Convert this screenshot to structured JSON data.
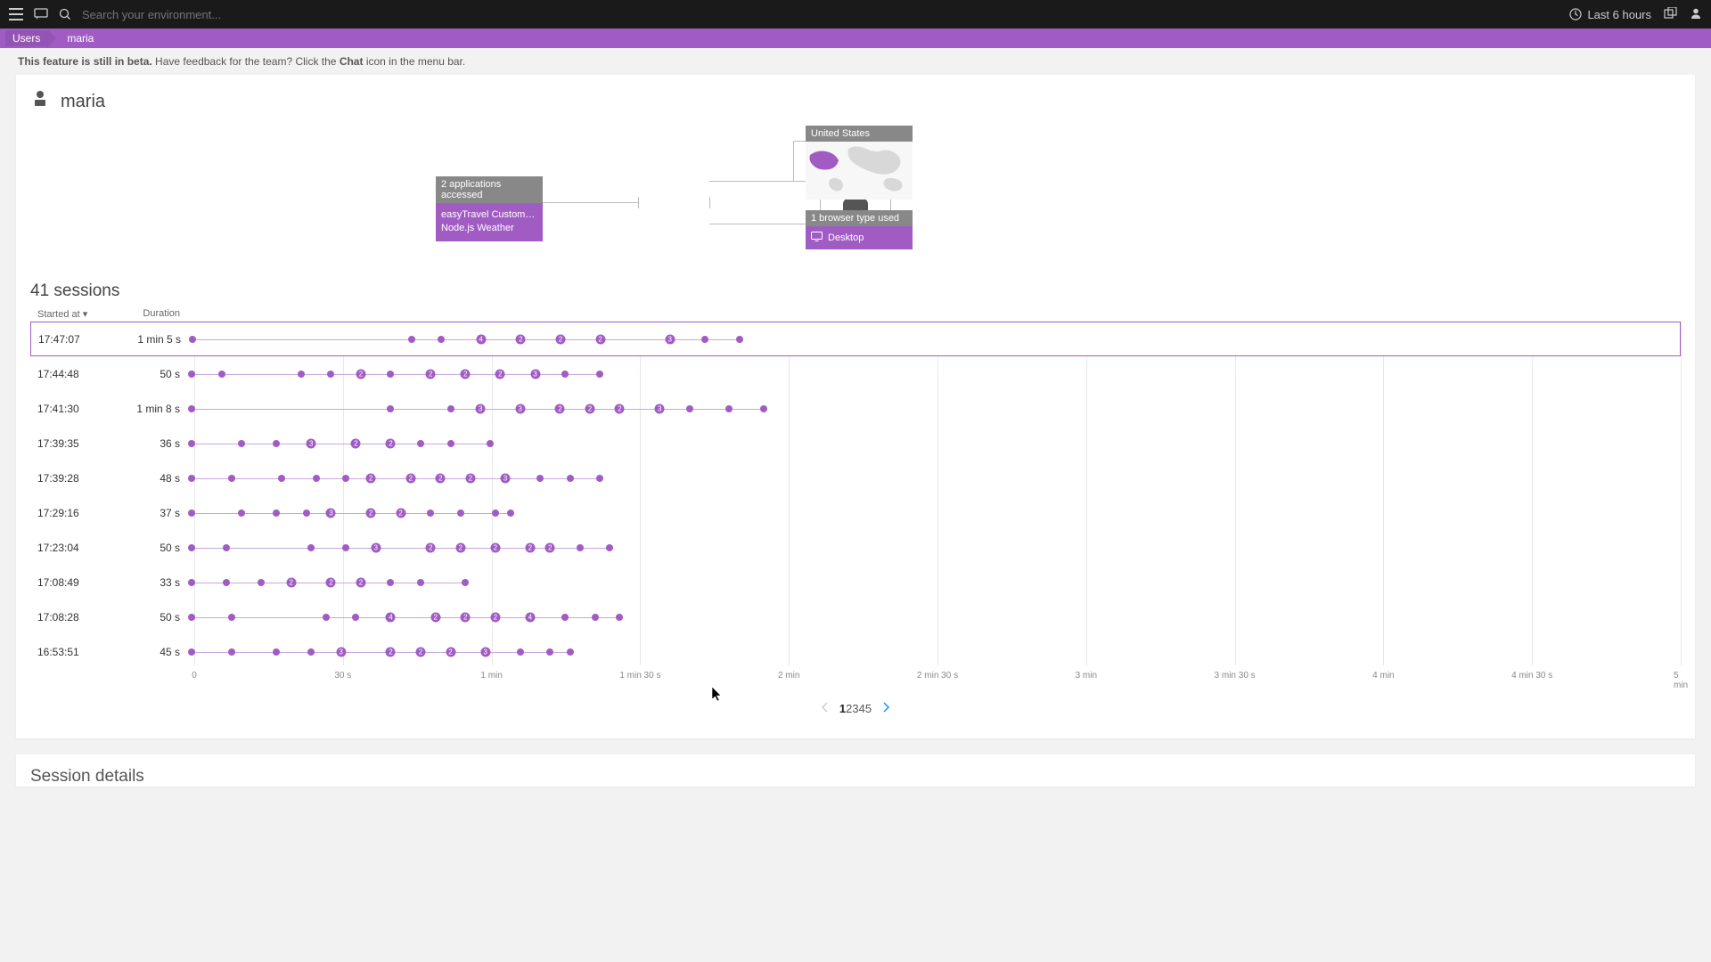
{
  "topbar": {
    "search_placeholder": "Search your environment...",
    "time_label": "Last 6 hours"
  },
  "breadcrumb": {
    "root": "Users",
    "current": "maria"
  },
  "beta": {
    "bold": "This feature is still in beta.",
    "prefix": " Have feedback for the team? Click the ",
    "chatword": "Chat",
    "suffix": " icon in the menu bar."
  },
  "user": {
    "name": "maria"
  },
  "summary": {
    "apps_hdr": "2 applications accessed",
    "apps": [
      "easyTravel Customer ...",
      "Node.js Weather"
    ],
    "country_hdr": "United States",
    "browser_hdr": "1 browser type used",
    "browser": "Desktop"
  },
  "sessions": {
    "title": "41 sessions",
    "col_start": "Started at ▾",
    "col_dur": "Duration",
    "axis_ticks": [
      "0",
      "30 s",
      "1 min",
      "1 min 30 s",
      "2 min",
      "2 min 30 s",
      "3 min",
      "3 min 30 s",
      "4 min",
      "4 min 30 s",
      "5 min"
    ],
    "rows": [
      {
        "time": "17:47:07",
        "dur": "1 min 5 s",
        "dur_s": 65,
        "selected": true,
        "events": [
          {
            "t": 0
          },
          {
            "t": 44
          },
          {
            "t": 50
          },
          {
            "t": 58,
            "n": "4"
          },
          {
            "t": 66,
            "n": "2"
          },
          {
            "t": 74,
            "n": "2"
          },
          {
            "t": 82,
            "n": "2"
          },
          {
            "t": 96,
            "n": "3"
          },
          {
            "t": 103
          },
          {
            "t": 110
          }
        ]
      },
      {
        "time": "17:44:48",
        "dur": "50 s",
        "dur_s": 50,
        "events": [
          {
            "t": 0
          },
          {
            "t": 6
          },
          {
            "t": 22
          },
          {
            "t": 28
          },
          {
            "t": 34,
            "n": "2"
          },
          {
            "t": 40
          },
          {
            "t": 48,
            "n": "2"
          },
          {
            "t": 55,
            "n": "2"
          },
          {
            "t": 62,
            "n": "2"
          },
          {
            "t": 69,
            "n": "3"
          },
          {
            "t": 75
          },
          {
            "t": 82
          }
        ]
      },
      {
        "time": "17:41:30",
        "dur": "1 min 8 s",
        "dur_s": 68,
        "events": [
          {
            "t": 0
          },
          {
            "t": 40
          },
          {
            "t": 52
          },
          {
            "t": 58,
            "n": "3"
          },
          {
            "t": 66,
            "n": "3"
          },
          {
            "t": 74,
            "n": "2"
          },
          {
            "t": 80,
            "n": "2"
          },
          {
            "t": 86,
            "n": "2"
          },
          {
            "t": 94,
            "n": "3"
          },
          {
            "t": 100
          },
          {
            "t": 108
          },
          {
            "t": 115
          }
        ]
      },
      {
        "time": "17:39:35",
        "dur": "36 s",
        "dur_s": 36,
        "events": [
          {
            "t": 0
          },
          {
            "t": 10
          },
          {
            "t": 17
          },
          {
            "t": 24,
            "n": "3"
          },
          {
            "t": 33,
            "n": "2"
          },
          {
            "t": 40,
            "n": "2"
          },
          {
            "t": 46
          },
          {
            "t": 52
          },
          {
            "t": 60
          }
        ]
      },
      {
        "time": "17:39:28",
        "dur": "48 s",
        "dur_s": 48,
        "events": [
          {
            "t": 0
          },
          {
            "t": 8
          },
          {
            "t": 18
          },
          {
            "t": 25
          },
          {
            "t": 31
          },
          {
            "t": 36,
            "n": "2"
          },
          {
            "t": 44,
            "n": "2"
          },
          {
            "t": 50,
            "n": "2"
          },
          {
            "t": 56,
            "n": "2"
          },
          {
            "t": 63,
            "n": "3"
          },
          {
            "t": 70
          },
          {
            "t": 76
          },
          {
            "t": 82
          }
        ]
      },
      {
        "time": "17:29:16",
        "dur": "37 s",
        "dur_s": 37,
        "events": [
          {
            "t": 0
          },
          {
            "t": 10
          },
          {
            "t": 17
          },
          {
            "t": 23
          },
          {
            "t": 28,
            "n": "3"
          },
          {
            "t": 36,
            "n": "2"
          },
          {
            "t": 42,
            "n": "2"
          },
          {
            "t": 48
          },
          {
            "t": 54
          },
          {
            "t": 61
          },
          {
            "t": 64
          }
        ]
      },
      {
        "time": "17:23:04",
        "dur": "50 s",
        "dur_s": 50,
        "events": [
          {
            "t": 0
          },
          {
            "t": 7
          },
          {
            "t": 24
          },
          {
            "t": 31
          },
          {
            "t": 37,
            "n": "3"
          },
          {
            "t": 48,
            "n": "2"
          },
          {
            "t": 54,
            "n": "2"
          },
          {
            "t": 61,
            "n": "2"
          },
          {
            "t": 68,
            "n": "2"
          },
          {
            "t": 72,
            "n": "2"
          },
          {
            "t": 78
          },
          {
            "t": 84
          }
        ]
      },
      {
        "time": "17:08:49",
        "dur": "33 s",
        "dur_s": 33,
        "events": [
          {
            "t": 0
          },
          {
            "t": 7
          },
          {
            "t": 14
          },
          {
            "t": 20,
            "n": "2"
          },
          {
            "t": 28,
            "n": "2"
          },
          {
            "t": 34,
            "n": "2"
          },
          {
            "t": 40
          },
          {
            "t": 46
          },
          {
            "t": 55
          }
        ]
      },
      {
        "time": "17:08:28",
        "dur": "50 s",
        "dur_s": 50,
        "events": [
          {
            "t": 0
          },
          {
            "t": 8
          },
          {
            "t": 27
          },
          {
            "t": 33
          },
          {
            "t": 40,
            "n": "4"
          },
          {
            "t": 49,
            "n": "2"
          },
          {
            "t": 55,
            "n": "2"
          },
          {
            "t": 61,
            "n": "2"
          },
          {
            "t": 68,
            "n": "4"
          },
          {
            "t": 75
          },
          {
            "t": 81
          },
          {
            "t": 86
          }
        ]
      },
      {
        "time": "16:53:51",
        "dur": "45 s",
        "dur_s": 45,
        "events": [
          {
            "t": 0
          },
          {
            "t": 8
          },
          {
            "t": 17
          },
          {
            "t": 24
          },
          {
            "t": 30,
            "n": "3"
          },
          {
            "t": 40,
            "n": "2"
          },
          {
            "t": 46,
            "n": "2"
          },
          {
            "t": 52,
            "n": "2"
          },
          {
            "t": 59,
            "n": "3"
          },
          {
            "t": 66
          },
          {
            "t": 72
          },
          {
            "t": 76
          }
        ]
      }
    ]
  },
  "pagination": {
    "pages": [
      "1",
      "2",
      "3",
      "4",
      "5"
    ],
    "active": "1"
  },
  "details": {
    "title": "Session details"
  },
  "chart_data": {
    "type": "scatter",
    "title": "41 sessions",
    "xlabel": "Duration",
    "ylabel": "Started at",
    "xlim": [
      0,
      300
    ],
    "x_tick_labels": [
      "0",
      "30 s",
      "1 min",
      "1 min 30 s",
      "2 min",
      "2 min 30 s",
      "3 min",
      "3 min 30 s",
      "4 min",
      "4 min 30 s",
      "5 min"
    ],
    "series": [
      {
        "name": "17:47:07",
        "duration_s": 65,
        "events": [
          {
            "t": 0
          },
          {
            "t": 44
          },
          {
            "t": 50
          },
          {
            "t": 58,
            "n": 4
          },
          {
            "t": 66,
            "n": 2
          },
          {
            "t": 74,
            "n": 2
          },
          {
            "t": 82,
            "n": 2
          },
          {
            "t": 96,
            "n": 3
          },
          {
            "t": 103
          },
          {
            "t": 110
          }
        ]
      },
      {
        "name": "17:44:48",
        "duration_s": 50,
        "events": [
          {
            "t": 0
          },
          {
            "t": 6
          },
          {
            "t": 22
          },
          {
            "t": 28
          },
          {
            "t": 34,
            "n": 2
          },
          {
            "t": 40
          },
          {
            "t": 48,
            "n": 2
          },
          {
            "t": 55,
            "n": 2
          },
          {
            "t": 62,
            "n": 2
          },
          {
            "t": 69,
            "n": 3
          },
          {
            "t": 75
          },
          {
            "t": 82
          }
        ]
      },
      {
        "name": "17:41:30",
        "duration_s": 68,
        "events": [
          {
            "t": 0
          },
          {
            "t": 40
          },
          {
            "t": 52
          },
          {
            "t": 58,
            "n": 3
          },
          {
            "t": 66,
            "n": 3
          },
          {
            "t": 74,
            "n": 2
          },
          {
            "t": 80,
            "n": 2
          },
          {
            "t": 86,
            "n": 2
          },
          {
            "t": 94,
            "n": 3
          },
          {
            "t": 100
          },
          {
            "t": 108
          },
          {
            "t": 115
          }
        ]
      },
      {
        "name": "17:39:35",
        "duration_s": 36,
        "events": [
          {
            "t": 0
          },
          {
            "t": 10
          },
          {
            "t": 17
          },
          {
            "t": 24,
            "n": 3
          },
          {
            "t": 33,
            "n": 2
          },
          {
            "t": 40,
            "n": 2
          },
          {
            "t": 46
          },
          {
            "t": 52
          },
          {
            "t": 60
          }
        ]
      },
      {
        "name": "17:39:28",
        "duration_s": 48,
        "events": [
          {
            "t": 0
          },
          {
            "t": 8
          },
          {
            "t": 18
          },
          {
            "t": 25
          },
          {
            "t": 31
          },
          {
            "t": 36,
            "n": 2
          },
          {
            "t": 44,
            "n": 2
          },
          {
            "t": 50,
            "n": 2
          },
          {
            "t": 56,
            "n": 2
          },
          {
            "t": 63,
            "n": 3
          },
          {
            "t": 70
          },
          {
            "t": 76
          },
          {
            "t": 82
          }
        ]
      },
      {
        "name": "17:29:16",
        "duration_s": 37,
        "events": [
          {
            "t": 0
          },
          {
            "t": 10
          },
          {
            "t": 17
          },
          {
            "t": 23
          },
          {
            "t": 28,
            "n": 3
          },
          {
            "t": 36,
            "n": 2
          },
          {
            "t": 42,
            "n": 2
          },
          {
            "t": 48
          },
          {
            "t": 54
          },
          {
            "t": 61
          },
          {
            "t": 64
          }
        ]
      },
      {
        "name": "17:23:04",
        "duration_s": 50,
        "events": [
          {
            "t": 0
          },
          {
            "t": 7
          },
          {
            "t": 24
          },
          {
            "t": 31
          },
          {
            "t": 37,
            "n": 3
          },
          {
            "t": 48,
            "n": 2
          },
          {
            "t": 54,
            "n": 2
          },
          {
            "t": 61,
            "n": 2
          },
          {
            "t": 68,
            "n": 2
          },
          {
            "t": 72,
            "n": 2
          },
          {
            "t": 78
          },
          {
            "t": 84
          }
        ]
      },
      {
        "name": "17:08:49",
        "duration_s": 33,
        "events": [
          {
            "t": 0
          },
          {
            "t": 7
          },
          {
            "t": 14
          },
          {
            "t": 20,
            "n": 2
          },
          {
            "t": 28,
            "n": 2
          },
          {
            "t": 34,
            "n": 2
          },
          {
            "t": 40
          },
          {
            "t": 46
          },
          {
            "t": 55
          }
        ]
      },
      {
        "name": "17:08:28",
        "duration_s": 50,
        "events": [
          {
            "t": 0
          },
          {
            "t": 8
          },
          {
            "t": 27
          },
          {
            "t": 33
          },
          {
            "t": 40,
            "n": 4
          },
          {
            "t": 49,
            "n": 2
          },
          {
            "t": 55,
            "n": 2
          },
          {
            "t": 61,
            "n": 2
          },
          {
            "t": 68,
            "n": 4
          },
          {
            "t": 75
          },
          {
            "t": 81
          },
          {
            "t": 86
          }
        ]
      },
      {
        "name": "16:53:51",
        "duration_s": 45,
        "events": [
          {
            "t": 0
          },
          {
            "t": 8
          },
          {
            "t": 17
          },
          {
            "t": 24
          },
          {
            "t": 30,
            "n": 3
          },
          {
            "t": 40,
            "n": 2
          },
          {
            "t": 46,
            "n": 2
          },
          {
            "t": 52,
            "n": 2
          },
          {
            "t": 59,
            "n": 3
          },
          {
            "t": 66
          },
          {
            "t": 72
          },
          {
            "t": 76
          }
        ]
      }
    ]
  }
}
